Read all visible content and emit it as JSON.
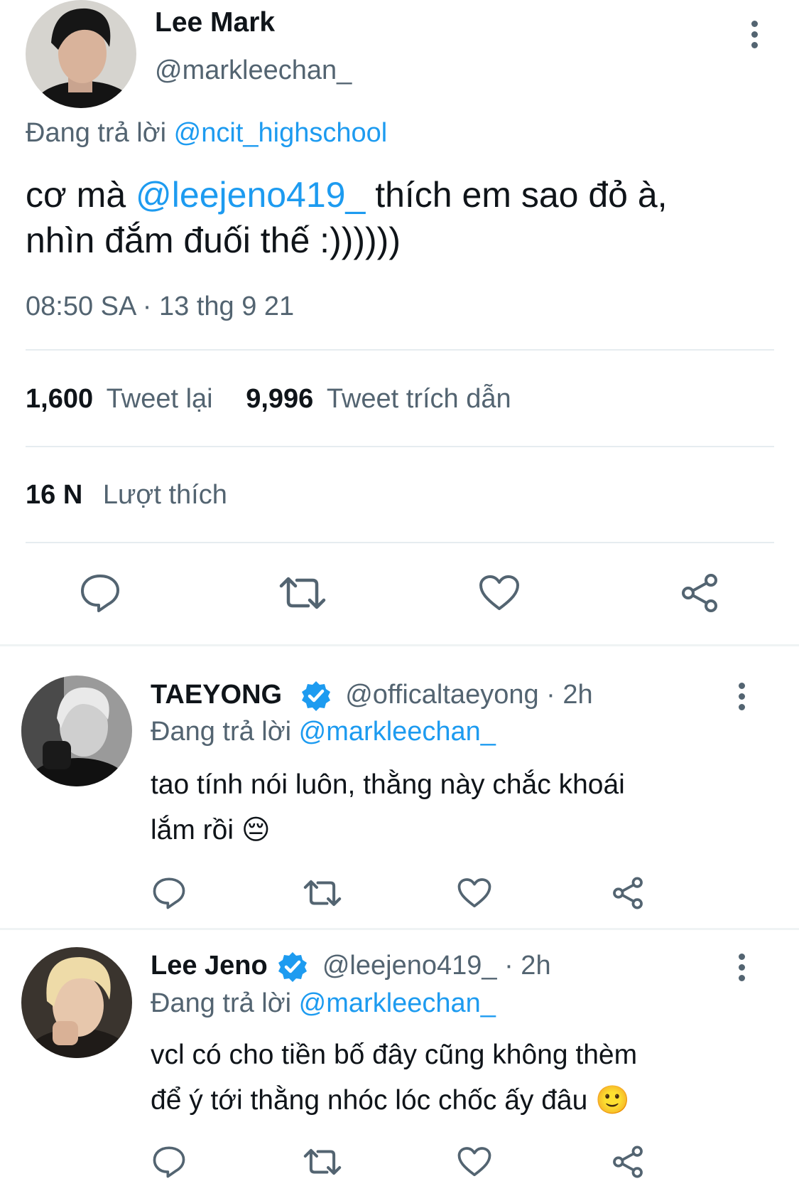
{
  "main_tweet": {
    "author_name": "Lee Mark",
    "handle": "@markleechan_",
    "reply_prefix": "Đang trả lời",
    "reply_to": "@ncit_highschool",
    "text_before": "cơ mà",
    "mention": "@leejeno419_",
    "text_after_line1": "thích em sao đỏ à,",
    "text_line2": "nhìn đắm đuối thế :))))))",
    "timestamp": "08:50 SA · 13 thg 9 21",
    "retweet_count": "1,600",
    "retweet_label": "Tweet lại",
    "quote_count": "9,996",
    "quote_label": "Tweet trích dẫn",
    "like_count": "16 N",
    "like_label": "Lượt thích"
  },
  "replies": [
    {
      "author_name": "TAEYONG",
      "handle": "@officaltaeyong",
      "time": "· 2h",
      "reply_prefix": "Đang trả lời",
      "reply_to": "@markleechan_",
      "line1": "tao tính nói luôn, thằng này chắc khoái",
      "line2": "lắm rồi",
      "emoji": "😔"
    },
    {
      "author_name": "Lee Jeno",
      "handle": "@leejeno419_",
      "time": "· 2h",
      "reply_prefix": "Đang trả lời",
      "reply_to": "@markleechan_",
      "line1": "vcl có cho tiền bố đây cũng không thèm",
      "line2": "để ý tới thằng nhóc lóc chốc ấy đâu",
      "emoji": "🙂"
    }
  ],
  "icons": {
    "reply": "comment-bubble-icon",
    "retweet": "retweet-arrows-icon",
    "like": "heart-icon",
    "share": "share-nodes-icon",
    "more": "more-vertical-icon",
    "verified": "verified-badge-icon"
  },
  "colors": {
    "link": "#1d9bf0",
    "secondary_text": "#536471",
    "verified": "#1d9bf0",
    "divider": "#e6ecf0"
  }
}
